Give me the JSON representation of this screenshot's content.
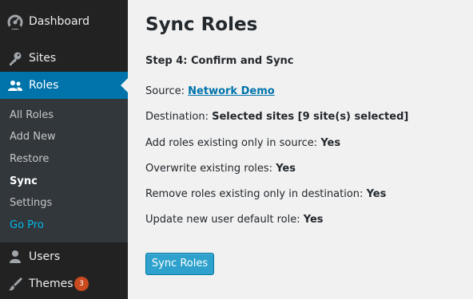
{
  "sidebar": {
    "dashboard": "Dashboard",
    "sites": "Sites",
    "roles": "Roles",
    "submenu": [
      "All Roles",
      "Add New",
      "Restore",
      "Sync",
      "Settings",
      "Go Pro"
    ],
    "users": "Users",
    "themes": "Themes",
    "themes_badge": "3"
  },
  "main": {
    "title": "Sync Roles",
    "step": "Step 4: Confirm and Sync",
    "source_label": "Source: ",
    "source_link": "Network Demo",
    "destination_label": "Destination: ",
    "destination_value": "Selected sites [9 site(s) selected]",
    "add_label": "Add roles existing only in source: ",
    "add_value": "Yes",
    "overwrite_label": "Overwrite existing roles: ",
    "overwrite_value": "Yes",
    "remove_label": "Remove roles existing only in destination: ",
    "remove_value": "Yes",
    "update_label": "Update new user default role: ",
    "update_value": "Yes",
    "button": "Sync Roles"
  },
  "colors": {
    "accent": "#0073aa",
    "button": "#2ea2cc",
    "badge": "#ca4a1f"
  }
}
